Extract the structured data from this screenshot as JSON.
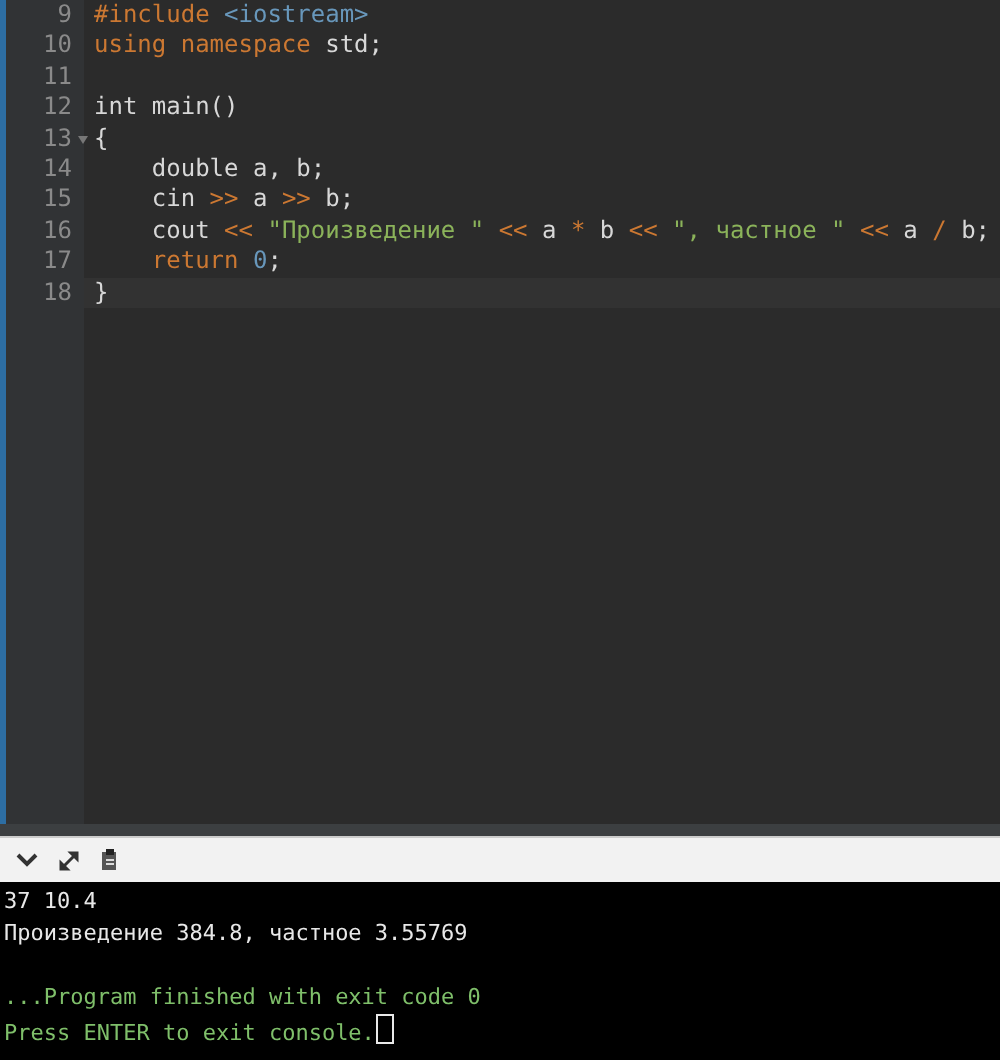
{
  "editor": {
    "lines": [
      {
        "number": "9",
        "tokens": [
          {
            "kind": "preproc",
            "text": "#include "
          },
          {
            "kind": "header",
            "text": "<iostream>"
          }
        ]
      },
      {
        "number": "10",
        "tokens": [
          {
            "kind": "keyword",
            "text": "using namespace "
          },
          {
            "kind": "plain",
            "text": "std;"
          }
        ]
      },
      {
        "number": "11"
      },
      {
        "number": "12",
        "tokens": [
          {
            "kind": "plain",
            "text": "int main()"
          }
        ]
      },
      {
        "number": "13",
        "fold": true,
        "tokens": [
          {
            "kind": "plain",
            "text": "{"
          }
        ]
      },
      {
        "number": "14",
        "tokens": [
          {
            "kind": "plain",
            "text": "    double a, b;"
          }
        ]
      },
      {
        "number": "15",
        "tokens": [
          {
            "kind": "plain",
            "text": "    cin "
          },
          {
            "kind": "operator",
            "text": ">> "
          },
          {
            "kind": "plain",
            "text": "a "
          },
          {
            "kind": "operator",
            "text": ">> "
          },
          {
            "kind": "plain",
            "text": "b;"
          }
        ]
      },
      {
        "number": "16",
        "tokens": [
          {
            "kind": "plain",
            "text": "    cout "
          },
          {
            "kind": "operator",
            "text": "<< "
          },
          {
            "kind": "string",
            "text": "\"Произведение \" "
          },
          {
            "kind": "operator",
            "text": "<< "
          },
          {
            "kind": "plain",
            "text": "a "
          },
          {
            "kind": "operator",
            "text": "* "
          },
          {
            "kind": "plain",
            "text": "b "
          },
          {
            "kind": "operator",
            "text": "<< "
          },
          {
            "kind": "string",
            "text": "\", частное \" "
          },
          {
            "kind": "operator",
            "text": "<< "
          },
          {
            "kind": "plain",
            "text": "a "
          },
          {
            "kind": "operator",
            "text": "/ "
          },
          {
            "kind": "plain",
            "text": "b;"
          }
        ]
      },
      {
        "number": "17",
        "tokens": [
          {
            "kind": "keyword",
            "text": "    return "
          },
          {
            "kind": "number",
            "text": "0"
          },
          {
            "kind": "plain",
            "text": ";"
          }
        ]
      },
      {
        "number": "18",
        "current": true,
        "tokens": [
          {
            "kind": "plain",
            "text": "}"
          }
        ]
      }
    ]
  },
  "console": {
    "output": [
      "37 10.4",
      "Произведение 384.8, частное 3.55769"
    ],
    "messages": [
      "...Program finished with exit code 0",
      "Press ENTER to exit console."
    ]
  }
}
